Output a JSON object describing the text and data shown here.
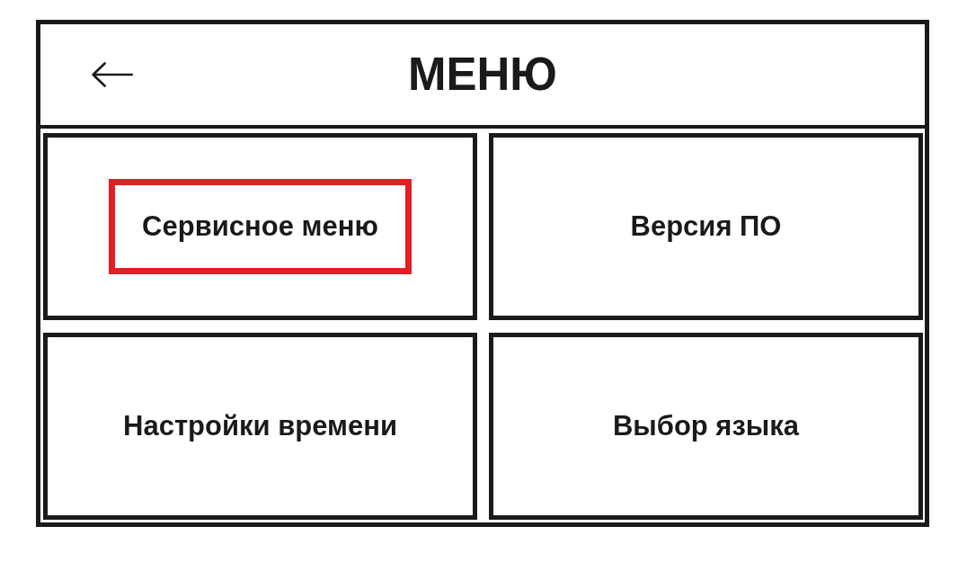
{
  "header": {
    "title": "МЕНЮ"
  },
  "items": [
    {
      "label": "Сервисное меню",
      "selected": true
    },
    {
      "label": "Версия ПО",
      "selected": false
    },
    {
      "label": "Настройки времени",
      "selected": false
    },
    {
      "label": "Выбор языка",
      "selected": false
    }
  ]
}
